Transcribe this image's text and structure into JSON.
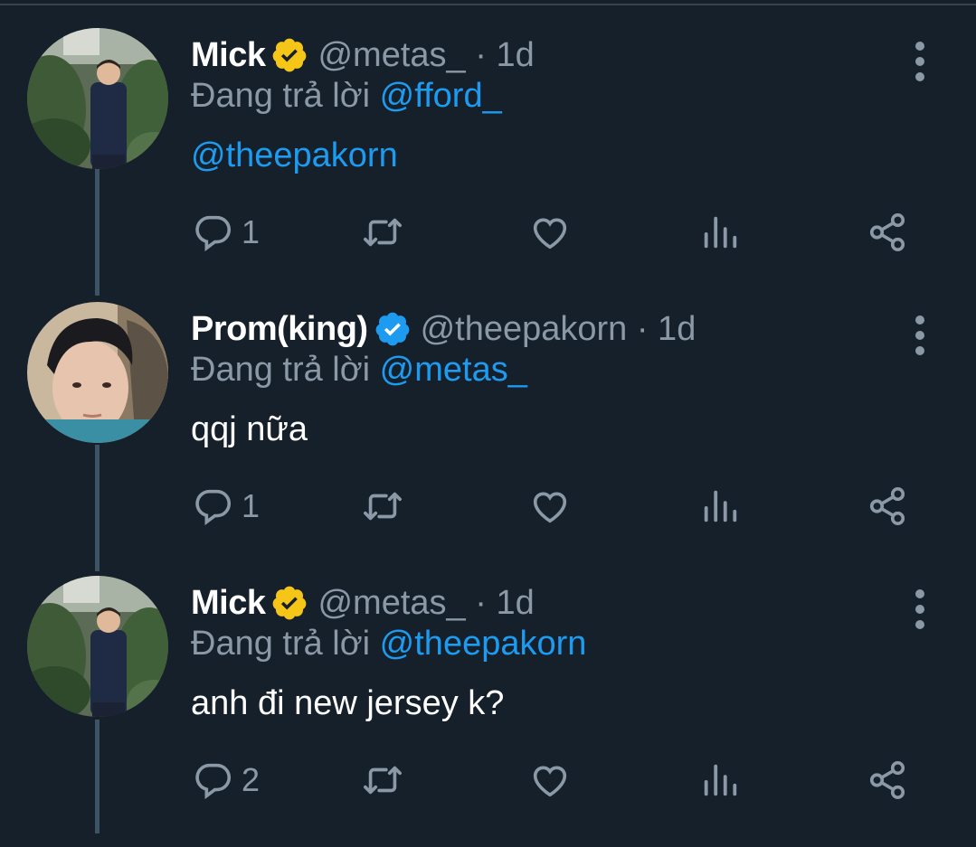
{
  "tweets": [
    {
      "name": "Mick",
      "badge_color": "#f5c518",
      "handle": "@metas_ · 1d",
      "reply_prefix": "Đang trả lời",
      "reply_to": "@fford_",
      "body": "@theepakorn",
      "body_is_link": true,
      "reply_count": "1",
      "avatar": "outdoor-photo"
    },
    {
      "name": "Prom(king)",
      "badge_color": "#1d9bf0",
      "handle": "@theepakorn · 1d",
      "reply_prefix": "Đang trả lời",
      "reply_to": "@metas_",
      "body": "qqj nữa",
      "body_is_link": false,
      "reply_count": "1",
      "avatar": "selfie-photo"
    },
    {
      "name": "Mick",
      "badge_color": "#f5c518",
      "handle": "@metas_ · 1d",
      "reply_prefix": "Đang trả lời",
      "reply_to": "@theepakorn",
      "body": "anh đi new jersey k?",
      "body_is_link": false,
      "reply_count": "2",
      "avatar": "outdoor-photo"
    }
  ],
  "icons": {
    "reply": "reply-icon",
    "retweet": "retweet-icon",
    "like": "like-icon",
    "views": "views-icon",
    "share": "share-icon",
    "more": "more-icon"
  },
  "colors": {
    "background": "#15202b",
    "text": "#ffffff",
    "secondary": "#8b98a5",
    "accent": "#1d9bf0"
  }
}
